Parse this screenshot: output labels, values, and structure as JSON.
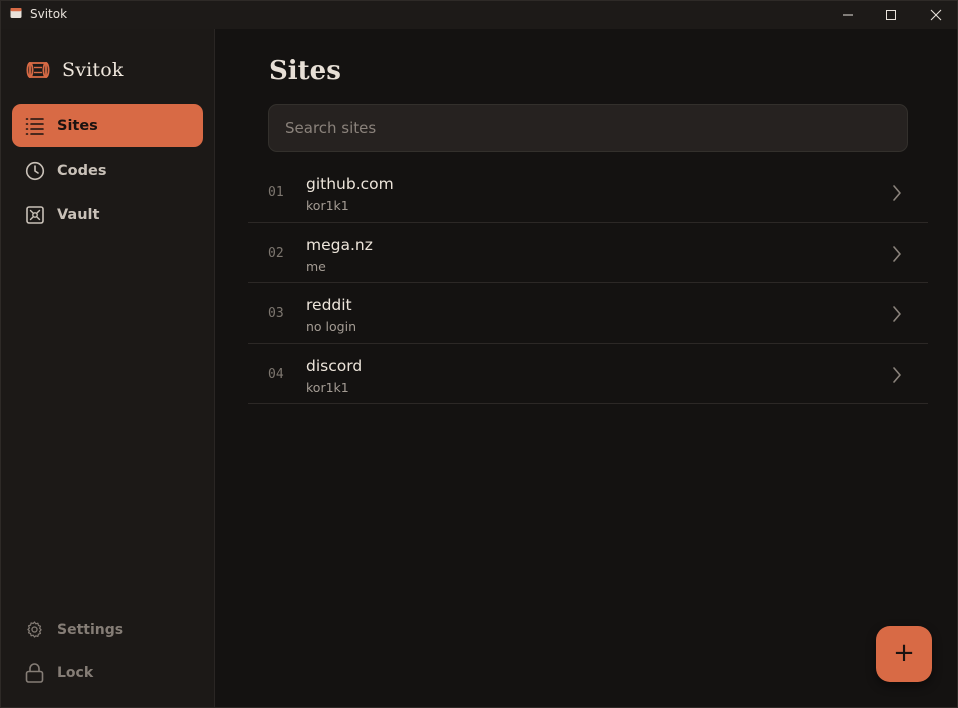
{
  "window": {
    "title": "Svitok"
  },
  "brand": {
    "name": "Svitok",
    "icon": "scroll-icon"
  },
  "colors": {
    "accent": "#d86a45",
    "sidebar_bg": "#1c1917",
    "main_bg": "#141211"
  },
  "sidebar": {
    "items": [
      {
        "id": "sites",
        "label": "Sites",
        "icon": "list-icon",
        "active": true
      },
      {
        "id": "codes",
        "label": "Codes",
        "icon": "clock-icon",
        "active": false
      },
      {
        "id": "vault",
        "label": "Vault",
        "icon": "vault-icon",
        "active": false
      }
    ],
    "bottom": [
      {
        "id": "settings",
        "label": "Settings",
        "icon": "gear-icon"
      },
      {
        "id": "lock",
        "label": "Lock",
        "icon": "lock-icon"
      }
    ]
  },
  "main": {
    "title": "Sites",
    "search": {
      "placeholder": "Search sites",
      "value": ""
    },
    "sites": [
      {
        "num": "01",
        "name": "github.com",
        "login": "kor1k1"
      },
      {
        "num": "02",
        "name": "mega.nz",
        "login": "me"
      },
      {
        "num": "03",
        "name": "reddit",
        "login": "no login"
      },
      {
        "num": "04",
        "name": "discord",
        "login": "kor1k1"
      }
    ],
    "fab": {
      "label": "+",
      "icon": "plus-icon"
    }
  }
}
